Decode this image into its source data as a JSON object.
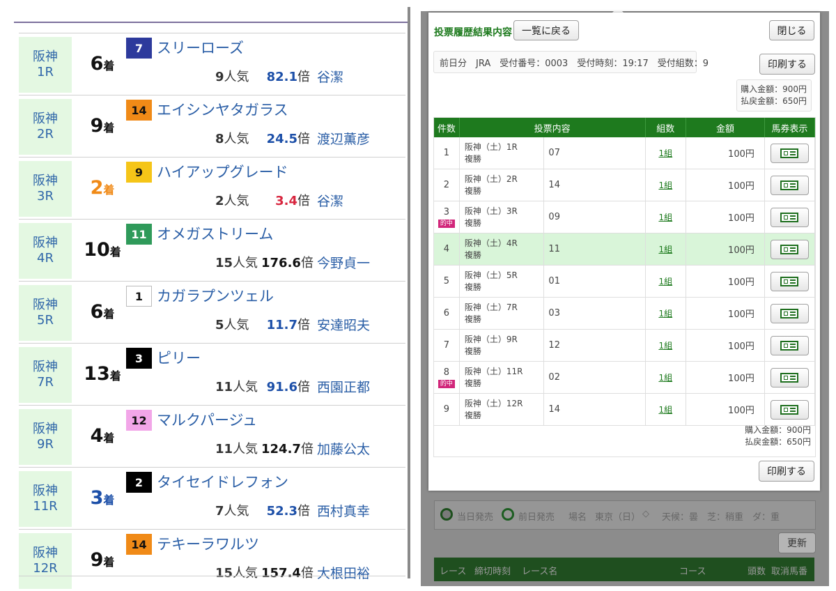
{
  "results": [
    {
      "venue": "阪神",
      "race": "1R",
      "place": "6",
      "place_suffix": "着",
      "place_color": "#111111",
      "number": "7",
      "badge_bg": "#2d3a9c",
      "badge_fg": "#ffffff",
      "horse": "スリーローズ",
      "popularity": "9",
      "pop_suffix": "人気",
      "odds": "82.1",
      "odds_color": "#1c4fa8",
      "odds_suffix": "倍",
      "jockey": "谷潔"
    },
    {
      "venue": "阪神",
      "race": "2R",
      "place": "9",
      "place_suffix": "着",
      "place_color": "#111111",
      "number": "14",
      "badge_bg": "#f08a17",
      "badge_fg": "#111111",
      "horse": "エイシンヤタガラス",
      "popularity": "8",
      "pop_suffix": "人気",
      "odds": "24.5",
      "odds_color": "#1c4fa8",
      "odds_suffix": "倍",
      "jockey": "渡辺薫彦"
    },
    {
      "venue": "阪神",
      "race": "3R",
      "place": "2",
      "place_suffix": "着",
      "place_color": "#f08a17",
      "number": "9",
      "badge_bg": "#f5c518",
      "badge_fg": "#111111",
      "horse": "ハイアップグレード",
      "popularity": "2",
      "pop_suffix": "人気",
      "odds": "3.4",
      "odds_color": "#d8263f",
      "odds_suffix": "倍",
      "jockey": "谷潔"
    },
    {
      "venue": "阪神",
      "race": "4R",
      "place": "10",
      "place_suffix": "着",
      "place_color": "#111111",
      "number": "11",
      "badge_bg": "#2f9a5a",
      "badge_fg": "#ffffff",
      "horse": "オメガストリーム",
      "popularity": "15",
      "pop_suffix": "人気",
      "odds": "176.6",
      "odds_color": "#111111",
      "odds_suffix": "倍",
      "jockey": "今野貞一"
    },
    {
      "venue": "阪神",
      "race": "5R",
      "place": "6",
      "place_suffix": "着",
      "place_color": "#111111",
      "number": "1",
      "badge_bg": "#ffffff",
      "badge_fg": "#111111",
      "horse": "カガラプンツェル",
      "popularity": "5",
      "pop_suffix": "人気",
      "odds": "11.7",
      "odds_color": "#1c4fa8",
      "odds_suffix": "倍",
      "jockey": "安達昭夫"
    },
    {
      "venue": "阪神",
      "race": "7R",
      "place": "13",
      "place_suffix": "着",
      "place_color": "#111111",
      "number": "3",
      "badge_bg": "#000000",
      "badge_fg": "#ffffff",
      "horse": "ピリー",
      "popularity": "11",
      "pop_suffix": "人気",
      "odds": "91.6",
      "odds_color": "#1c4fa8",
      "odds_suffix": "倍",
      "jockey": "西園正都"
    },
    {
      "venue": "阪神",
      "race": "9R",
      "place": "4",
      "place_suffix": "着",
      "place_color": "#111111",
      "number": "12",
      "badge_bg": "#f2a6e8",
      "badge_fg": "#111111",
      "horse": "マルクパージュ",
      "popularity": "11",
      "pop_suffix": "人気",
      "odds": "124.7",
      "odds_color": "#111111",
      "odds_suffix": "倍",
      "jockey": "加藤公太"
    },
    {
      "venue": "阪神",
      "race": "11R",
      "place": "3",
      "place_suffix": "着",
      "place_color": "#1c4fa8",
      "number": "2",
      "badge_bg": "#000000",
      "badge_fg": "#ffffff",
      "horse": "タイセイドレフォン",
      "popularity": "7",
      "pop_suffix": "人気",
      "odds": "52.3",
      "odds_color": "#1c4fa8",
      "odds_suffix": "倍",
      "jockey": "西村真幸"
    },
    {
      "venue": "阪神",
      "race": "12R",
      "place": "9",
      "place_suffix": "着",
      "place_color": "#111111",
      "number": "14",
      "badge_bg": "#f08a17",
      "badge_fg": "#111111",
      "horse": "テキーラワルツ",
      "popularity": "15",
      "pop_suffix": "人気",
      "odds": "157.4",
      "odds_color": "#111111",
      "odds_suffix": "倍",
      "jockey": "大根田裕"
    }
  ],
  "modal": {
    "title": "投票履歴結果内容",
    "back_label": "一覧に戻る",
    "close_label": "閉じる",
    "print_label": "印刷する",
    "info": "前日分　JRA　受付番号：0003　受付時刻：19:17　受付組数：9",
    "purchase": "購入金額：900円",
    "refund": "払戻金額：650円",
    "headers": [
      "件数",
      "投票内容",
      "組数",
      "金額",
      "馬券表示"
    ],
    "hit_label": "的中",
    "ticket_icon": "ticket-icon",
    "hit_row_color": "#d9f5d9",
    "bets": [
      {
        "no": "1",
        "race": "阪神（土）1R",
        "type": "複勝",
        "content": "07",
        "sets": "1組",
        "amount": "100円",
        "hit": false
      },
      {
        "no": "2",
        "race": "阪神（土）2R",
        "type": "複勝",
        "content": "14",
        "sets": "1組",
        "amount": "100円",
        "hit": false
      },
      {
        "no": "3",
        "race": "阪神（土）3R",
        "type": "複勝",
        "content": "09",
        "sets": "1組",
        "amount": "100円",
        "hit": true
      },
      {
        "no": "4",
        "race": "阪神（土）4R",
        "type": "複勝",
        "content": "11",
        "sets": "1組",
        "amount": "100円",
        "hit": false,
        "highlight": true
      },
      {
        "no": "5",
        "race": "阪神（土）5R",
        "type": "複勝",
        "content": "01",
        "sets": "1組",
        "amount": "100円",
        "hit": false
      },
      {
        "no": "6",
        "race": "阪神（土）7R",
        "type": "複勝",
        "content": "03",
        "sets": "1組",
        "amount": "100円",
        "hit": false
      },
      {
        "no": "7",
        "race": "阪神（土）9R",
        "type": "複勝",
        "content": "12",
        "sets": "1組",
        "amount": "100円",
        "hit": false
      },
      {
        "no": "8",
        "race": "阪神（土）11R",
        "type": "複勝",
        "content": "02",
        "sets": "1組",
        "amount": "100円",
        "hit": true
      },
      {
        "no": "9",
        "race": "阪神（土）12R",
        "type": "複勝",
        "content": "14",
        "sets": "1組",
        "amount": "100円",
        "hit": false
      }
    ]
  },
  "background": {
    "radio_today": "当日発売",
    "radio_prev": "前日発売",
    "venue_label": "場名",
    "venue_value": "東京（日）",
    "weather": "天候：曇　芝：稍重　ダ：重",
    "update_label": "更新",
    "cols": [
      "レース",
      "締切時刻",
      "レース名",
      "コース",
      "頭数",
      "取消馬番"
    ]
  }
}
